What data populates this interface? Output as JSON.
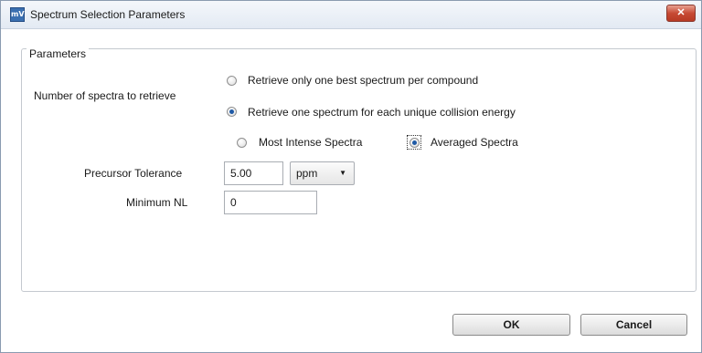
{
  "window": {
    "title": "Spectrum Selection Parameters",
    "icon_glyph": "mV",
    "close_glyph": "✕",
    "icon_name": "app-icon"
  },
  "group": {
    "legend": "Parameters"
  },
  "spectra": {
    "label": "Number of spectra to retrieve",
    "option_best": "Retrieve only one best spectrum per compound",
    "option_each": "Retrieve one spectrum for each unique collision energy",
    "selected": "option_each"
  },
  "spectra_type": {
    "option_intense": "Most Intense Spectra",
    "option_averaged": "Averaged Spectra",
    "selected": "option_averaged"
  },
  "precursor": {
    "label": "Precursor Tolerance",
    "value": "5.00",
    "unit": "ppm",
    "dropdown_glyph": "▼"
  },
  "minimum_nl": {
    "label": "Minimum NL",
    "value": "0"
  },
  "buttons": {
    "ok": "OK",
    "cancel": "Cancel"
  },
  "colors": {
    "accent": "#1f5aa6",
    "close_button": "#c74a34"
  }
}
